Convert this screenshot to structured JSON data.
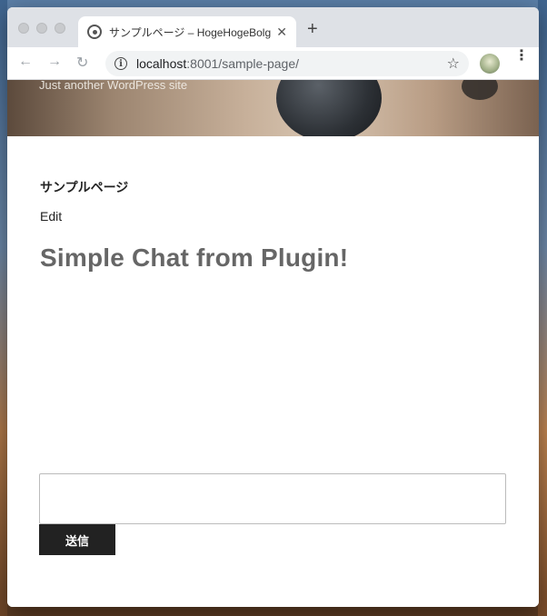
{
  "browser": {
    "tab_title": "サンプルページ – HogeHogeBolg",
    "tab_close": "✕",
    "new_tab": "+",
    "url_host": "localhost",
    "url_path": ":8001/sample-page/",
    "icons": {
      "back": "arrow-left-icon",
      "forward": "arrow-right-icon",
      "reload": "reload-icon",
      "info": "info-icon",
      "star": "star-icon",
      "menu": "kebab-menu-icon"
    }
  },
  "site": {
    "description": "Just another WordPress site"
  },
  "page": {
    "title": "サンプルページ",
    "edit_link": "Edit",
    "chat_heading": "Simple Chat from Plugin!",
    "chat_input_value": "",
    "send_button": "送信"
  },
  "colors": {
    "send_button_bg": "#222222",
    "heading_color": "#666666"
  }
}
